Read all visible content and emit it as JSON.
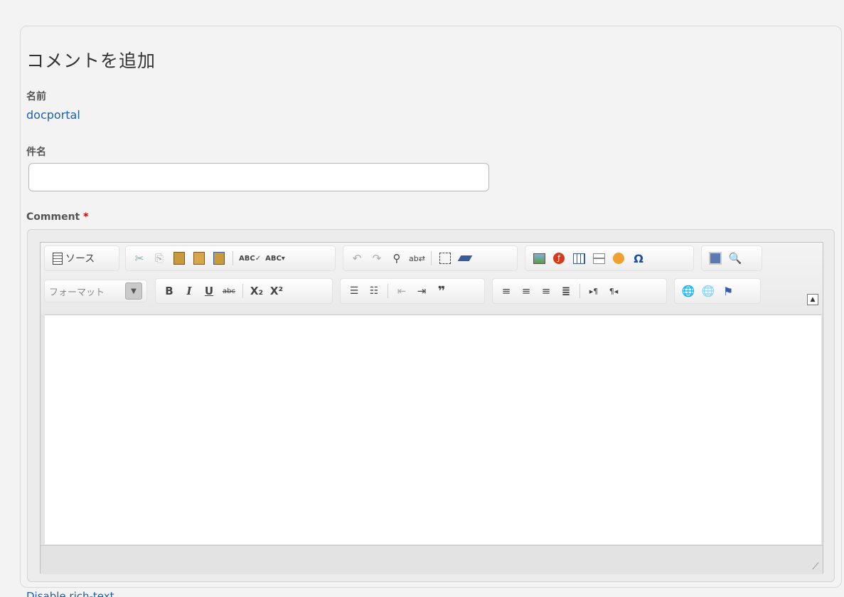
{
  "form": {
    "title": "コメントを追加",
    "name_label": "名前",
    "name_value": "docportal",
    "subject_label": "件名",
    "subject_value": "",
    "comment_label": "Comment",
    "required_mark": "*"
  },
  "editor": {
    "source_label": "ソース",
    "format_label": "フォーマット",
    "toolbar_row1": {
      "source": "source-icon",
      "clipboard": [
        "cut-icon",
        "copy-icon",
        "paste-icon",
        "paste-text-icon",
        "paste-word-icon"
      ],
      "spell": [
        "spellcheck-icon",
        "spellcheck-as-you-type-icon"
      ],
      "history": [
        "undo-icon",
        "redo-icon",
        "find-icon",
        "replace-icon",
        "select-all-icon",
        "remove-format-icon"
      ],
      "insert": [
        "image-icon",
        "flash-icon",
        "table-icon",
        "horizontal-rule-icon",
        "smiley-icon",
        "special-char-icon"
      ],
      "view": [
        "maximize-icon",
        "preview-icon"
      ]
    },
    "toolbar_row2": {
      "basic": [
        "bold-icon",
        "italic-icon",
        "underline-icon",
        "strike-icon",
        "subscript-icon",
        "superscript-icon"
      ],
      "list": [
        "numbered-list-icon",
        "bulleted-list-icon",
        "outdent-icon",
        "indent-icon",
        "blockquote-icon"
      ],
      "align": [
        "align-left-icon",
        "align-center-icon",
        "align-right-icon",
        "align-justify-icon",
        "ltr-icon",
        "rtl-icon"
      ],
      "links": [
        "link-icon",
        "unlink-icon",
        "anchor-icon"
      ]
    },
    "glyphs": {
      "bold": "B",
      "italic": "I",
      "underline": "U",
      "strike": "abc",
      "sub": "X₂",
      "sup": "X²"
    }
  },
  "footer": {
    "link_label": "Disable rich-text"
  }
}
